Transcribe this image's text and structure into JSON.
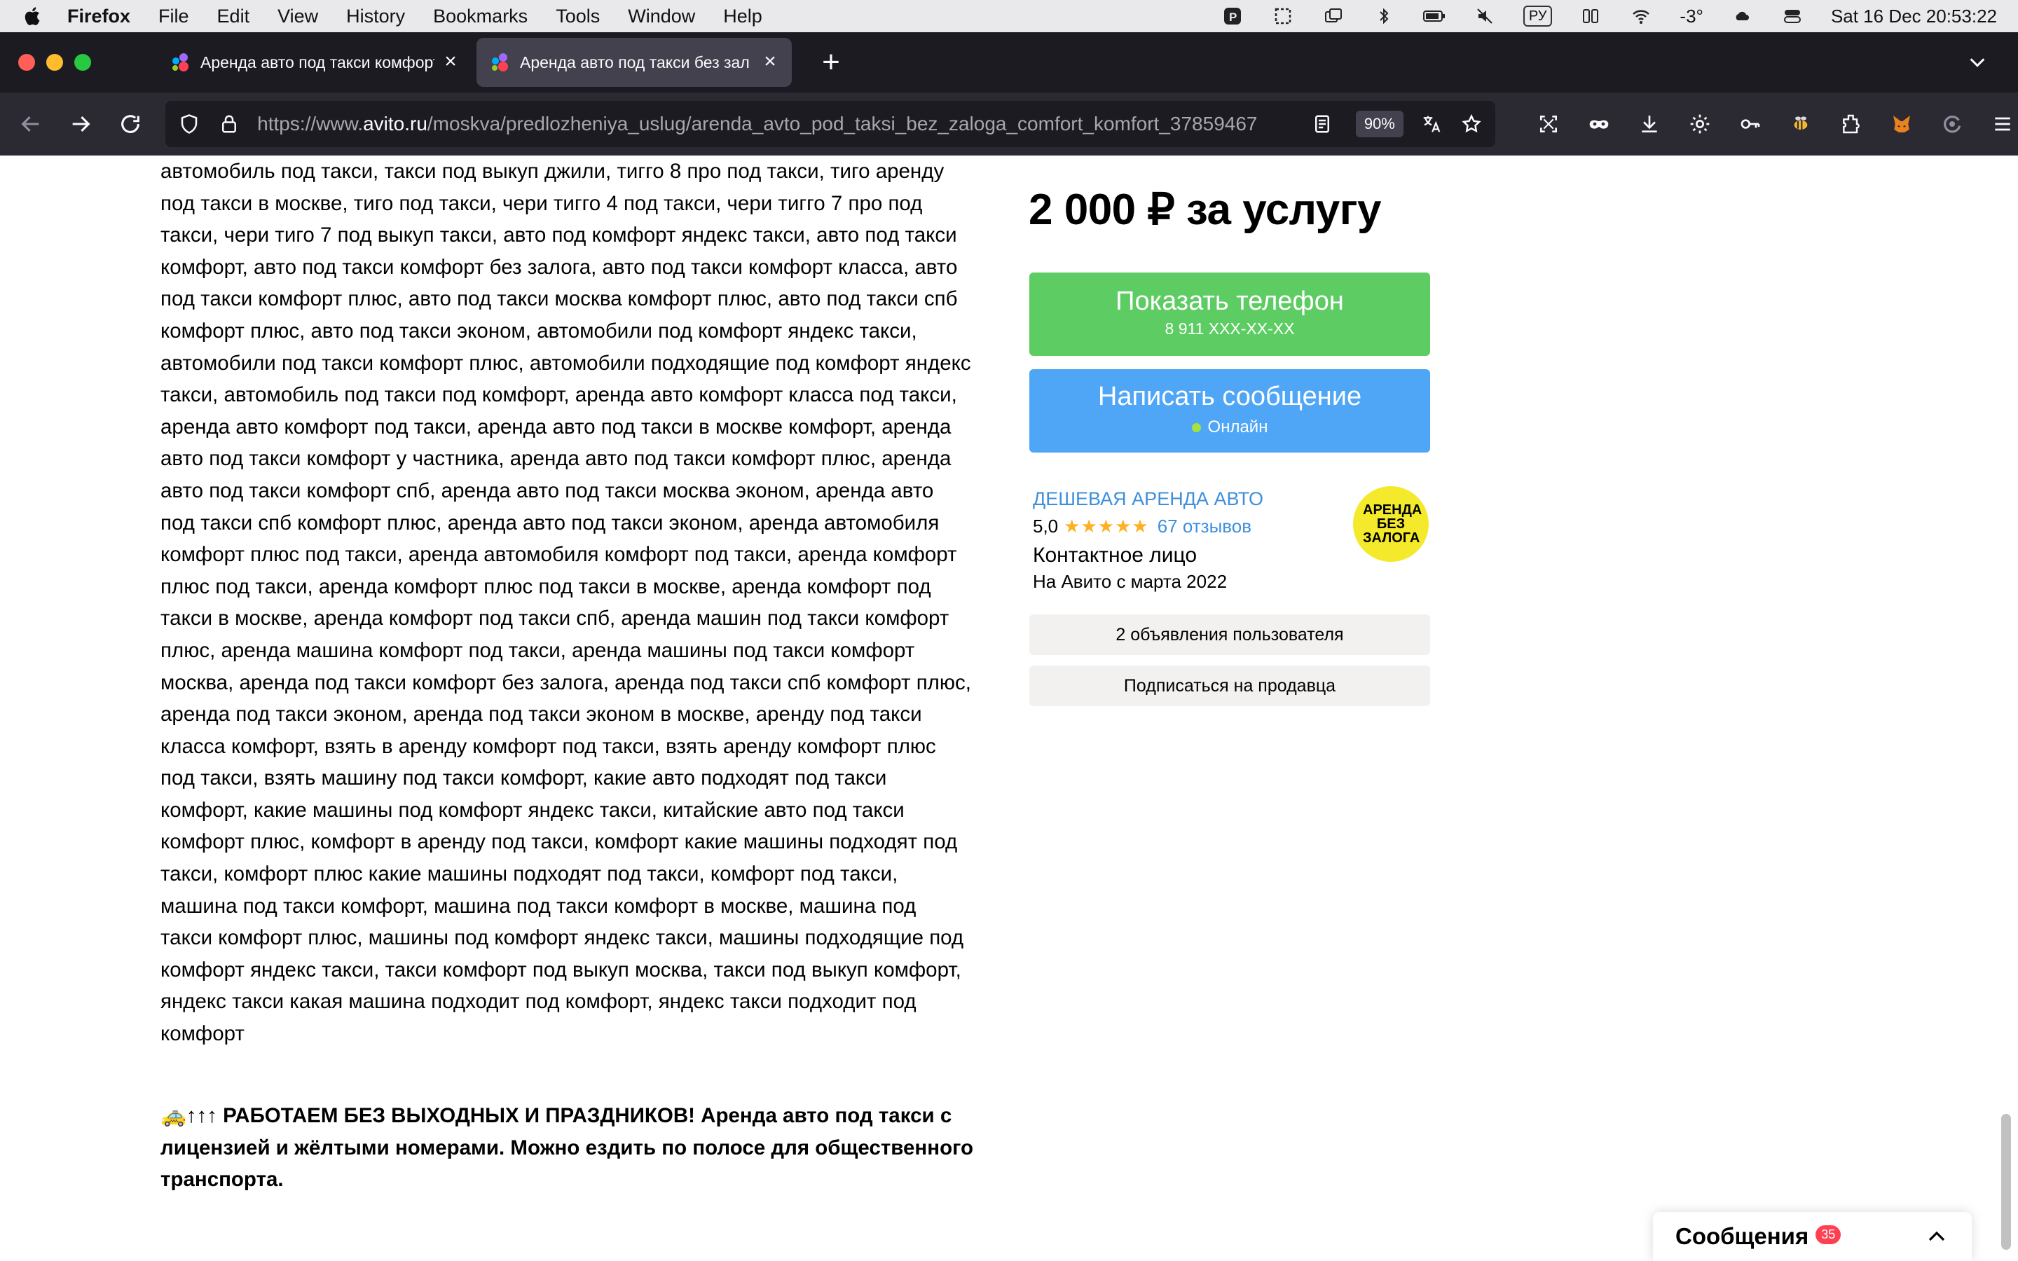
{
  "menubar": {
    "app": "Firefox",
    "items": [
      "File",
      "Edit",
      "View",
      "History",
      "Bookmarks",
      "Tools",
      "Window",
      "Help"
    ],
    "lang": "РУ",
    "temp": "-3°",
    "datetime": "Sat 16 Dec  20:53:22"
  },
  "tabs": [
    {
      "title": "Аренда авто под такси комфорт",
      "active": false
    },
    {
      "title": "Аренда авто под такси без зал",
      "active": true
    }
  ],
  "navbar": {
    "url_prefix": "https://www.",
    "url_domain": "avito.ru",
    "url_path": "/moskva/predlozheniya_uslug/arenda_avto_pod_taksi_bez_zaloga_comfort_komfort_37859467",
    "zoom": "90%"
  },
  "content": {
    "description": "автомобиль под такси, такси под выкуп джили, тигго 8 про под такси, тиго аренду под такси в москве, тиго под такси, чери тигго 4 под такси, чери тигго 7 про под такси, чери тиго 7 под выкуп такси, авто под комфорт яндекс такси, авто под такси комфорт, авто под такси комфорт без залога, авто под такси комфорт класса, авто под такси комфорт плюс, авто под такси москва комфорт плюс, авто под такси спб комфорт плюс, авто под такси эконом, автомобили под комфорт яндекс такси, автомобили под такси комфорт плюс, автомобили подходящие под комфорт яндекс такси, автомобиль под такси под комфорт, аренда авто комфорт класса под такси, аренда авто комфорт под такси, аренда авто под такси в москве комфорт, аренда авто под такси комфорт у частника, аренда авто под такси комфорт плюс, аренда авто под такси комфорт спб, аренда авто под такси москва эконом, аренда авто под такси спб комфорт плюс, аренда авто под такси эконом, аренда автомобиля комфорт плюс под такси, аренда автомобиля комфорт под такси, аренда комфорт плюс под такси, аренда комфорт плюс под такси в москве, аренда комфорт под такси в москве, аренда комфорт под такси спб, аренда машин под такси комфорт плюс, аренда машина комфорт под такси, аренда машины под такси комфорт москва, аренда под такси комфорт без залога, аренда под такси спб комфорт плюс, аренда под такси эконом, аренда под такси эконом в москве, аренду под такси класса комфорт, взять в аренду комфорт под такси, взять аренду комфорт плюс под такси, взять машину под такси комфорт, какие авто подходят под такси комфорт, какие машины под комфорт яндекс такси, китайские авто под такси комфорт плюс, комфорт в аренду под такси, комфорт какие машины подходят под такси, комфорт плюс какие машины подходят под такси, комфорт под такси, машина под такси комфорт, машина под такси комфорт в москве, машина под такси комфорт плюс, машины под комфорт яндекс такси, машины подходящие под комфорт яндекс такси, такси комфорт под выкуп москва, такси под выкуп комфорт, яндекс такси какая машина подходит под комфорт, яндекс такси подходит под комфорт",
    "bold_note": "🚕↑↑↑ РАБОТАЕМ БЕЗ ВЫХОДНЫХ И ПРАЗДНИКОВ! Аренда авто под такси с лицензией и жёлтыми номерами. Можно ездить по полосе для общественного транспорта."
  },
  "sidebar": {
    "price": "2 000 ₽ за услугу",
    "phone_button": {
      "label": "Показать телефон",
      "number": "8 911 XXX-XX-XX"
    },
    "message_button": {
      "label": "Написать сообщение",
      "status": "Онлайн"
    },
    "seller": {
      "name": "ДЕШЕВАЯ АРЕНДА АВТО",
      "rating": "5,0",
      "stars": "★★★★★",
      "reviews": "67 отзывов",
      "contact": "Контактное лицо",
      "since": "На Авито с марта 2022",
      "logo_text": "АРЕНДА БЕЗ ЗАЛОГА"
    },
    "listings_button": "2 объявления пользователя",
    "subscribe_button": "Подписаться на продавца"
  },
  "messages": {
    "label": "Сообщения",
    "count": "35"
  },
  "colors": {
    "phone_green": "#5dcc63",
    "message_blue": "#4fa6f6",
    "link_blue": "#3e8fdc",
    "star_orange": "#ffb021",
    "logo_yellow": "#f4ea2b",
    "badge_red": "#ff4053"
  }
}
